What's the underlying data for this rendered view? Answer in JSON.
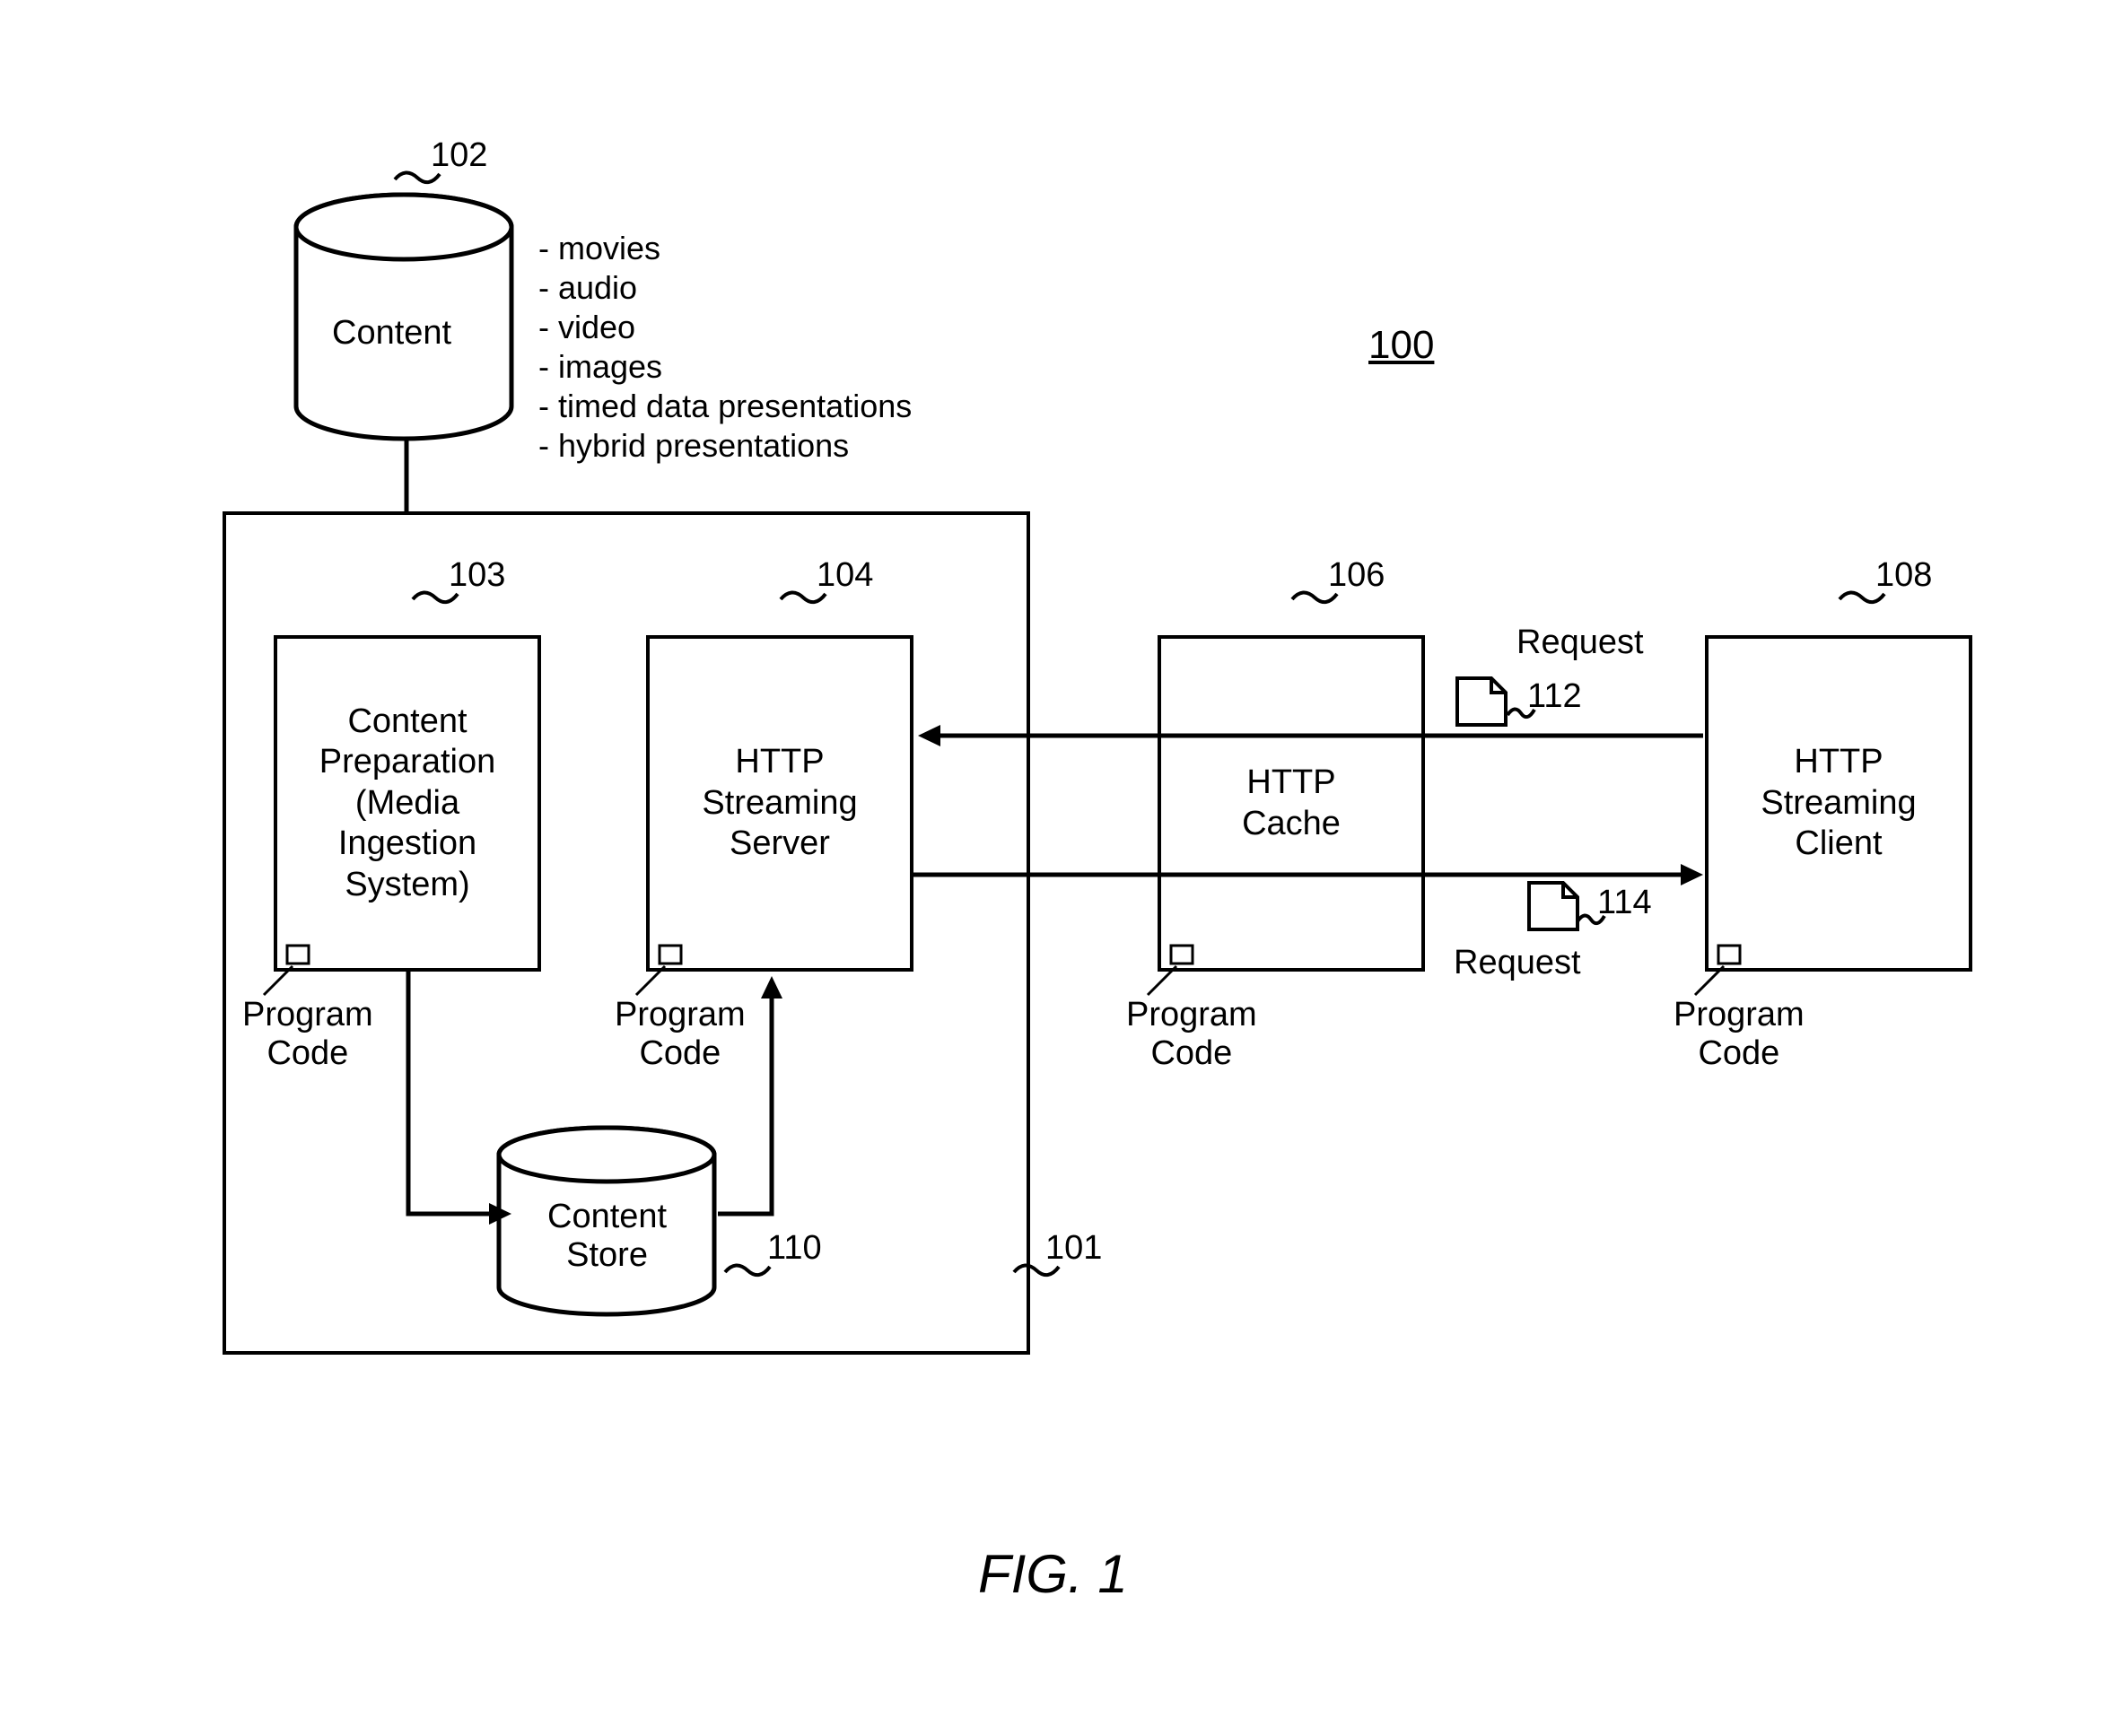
{
  "figure": {
    "title": "FIG. 1",
    "system_ref": "100"
  },
  "content_db": {
    "label": "Content",
    "ref": "102",
    "types": "- movies\n- audio\n- video\n- images\n- timed data presentations\n- hybrid presentations"
  },
  "host_box": {
    "ref": "101"
  },
  "content_prep": {
    "label": "Content\nPreparation\n(Media\nIngestion\nSystem)",
    "ref": "103",
    "program_code": "Program\nCode"
  },
  "http_server": {
    "label": "HTTP\nStreaming\nServer",
    "ref": "104",
    "program_code": "Program\nCode"
  },
  "content_store": {
    "label": "Content\nStore",
    "ref": "110"
  },
  "http_cache": {
    "label": "HTTP\nCache",
    "ref": "106",
    "program_code": "Program\nCode"
  },
  "http_client": {
    "label": "HTTP\nStreaming\nClient",
    "ref": "108",
    "program_code": "Program\nCode"
  },
  "request_top": {
    "label": "Request",
    "ref": "112"
  },
  "request_bottom": {
    "label": "Request",
    "ref": "114"
  }
}
